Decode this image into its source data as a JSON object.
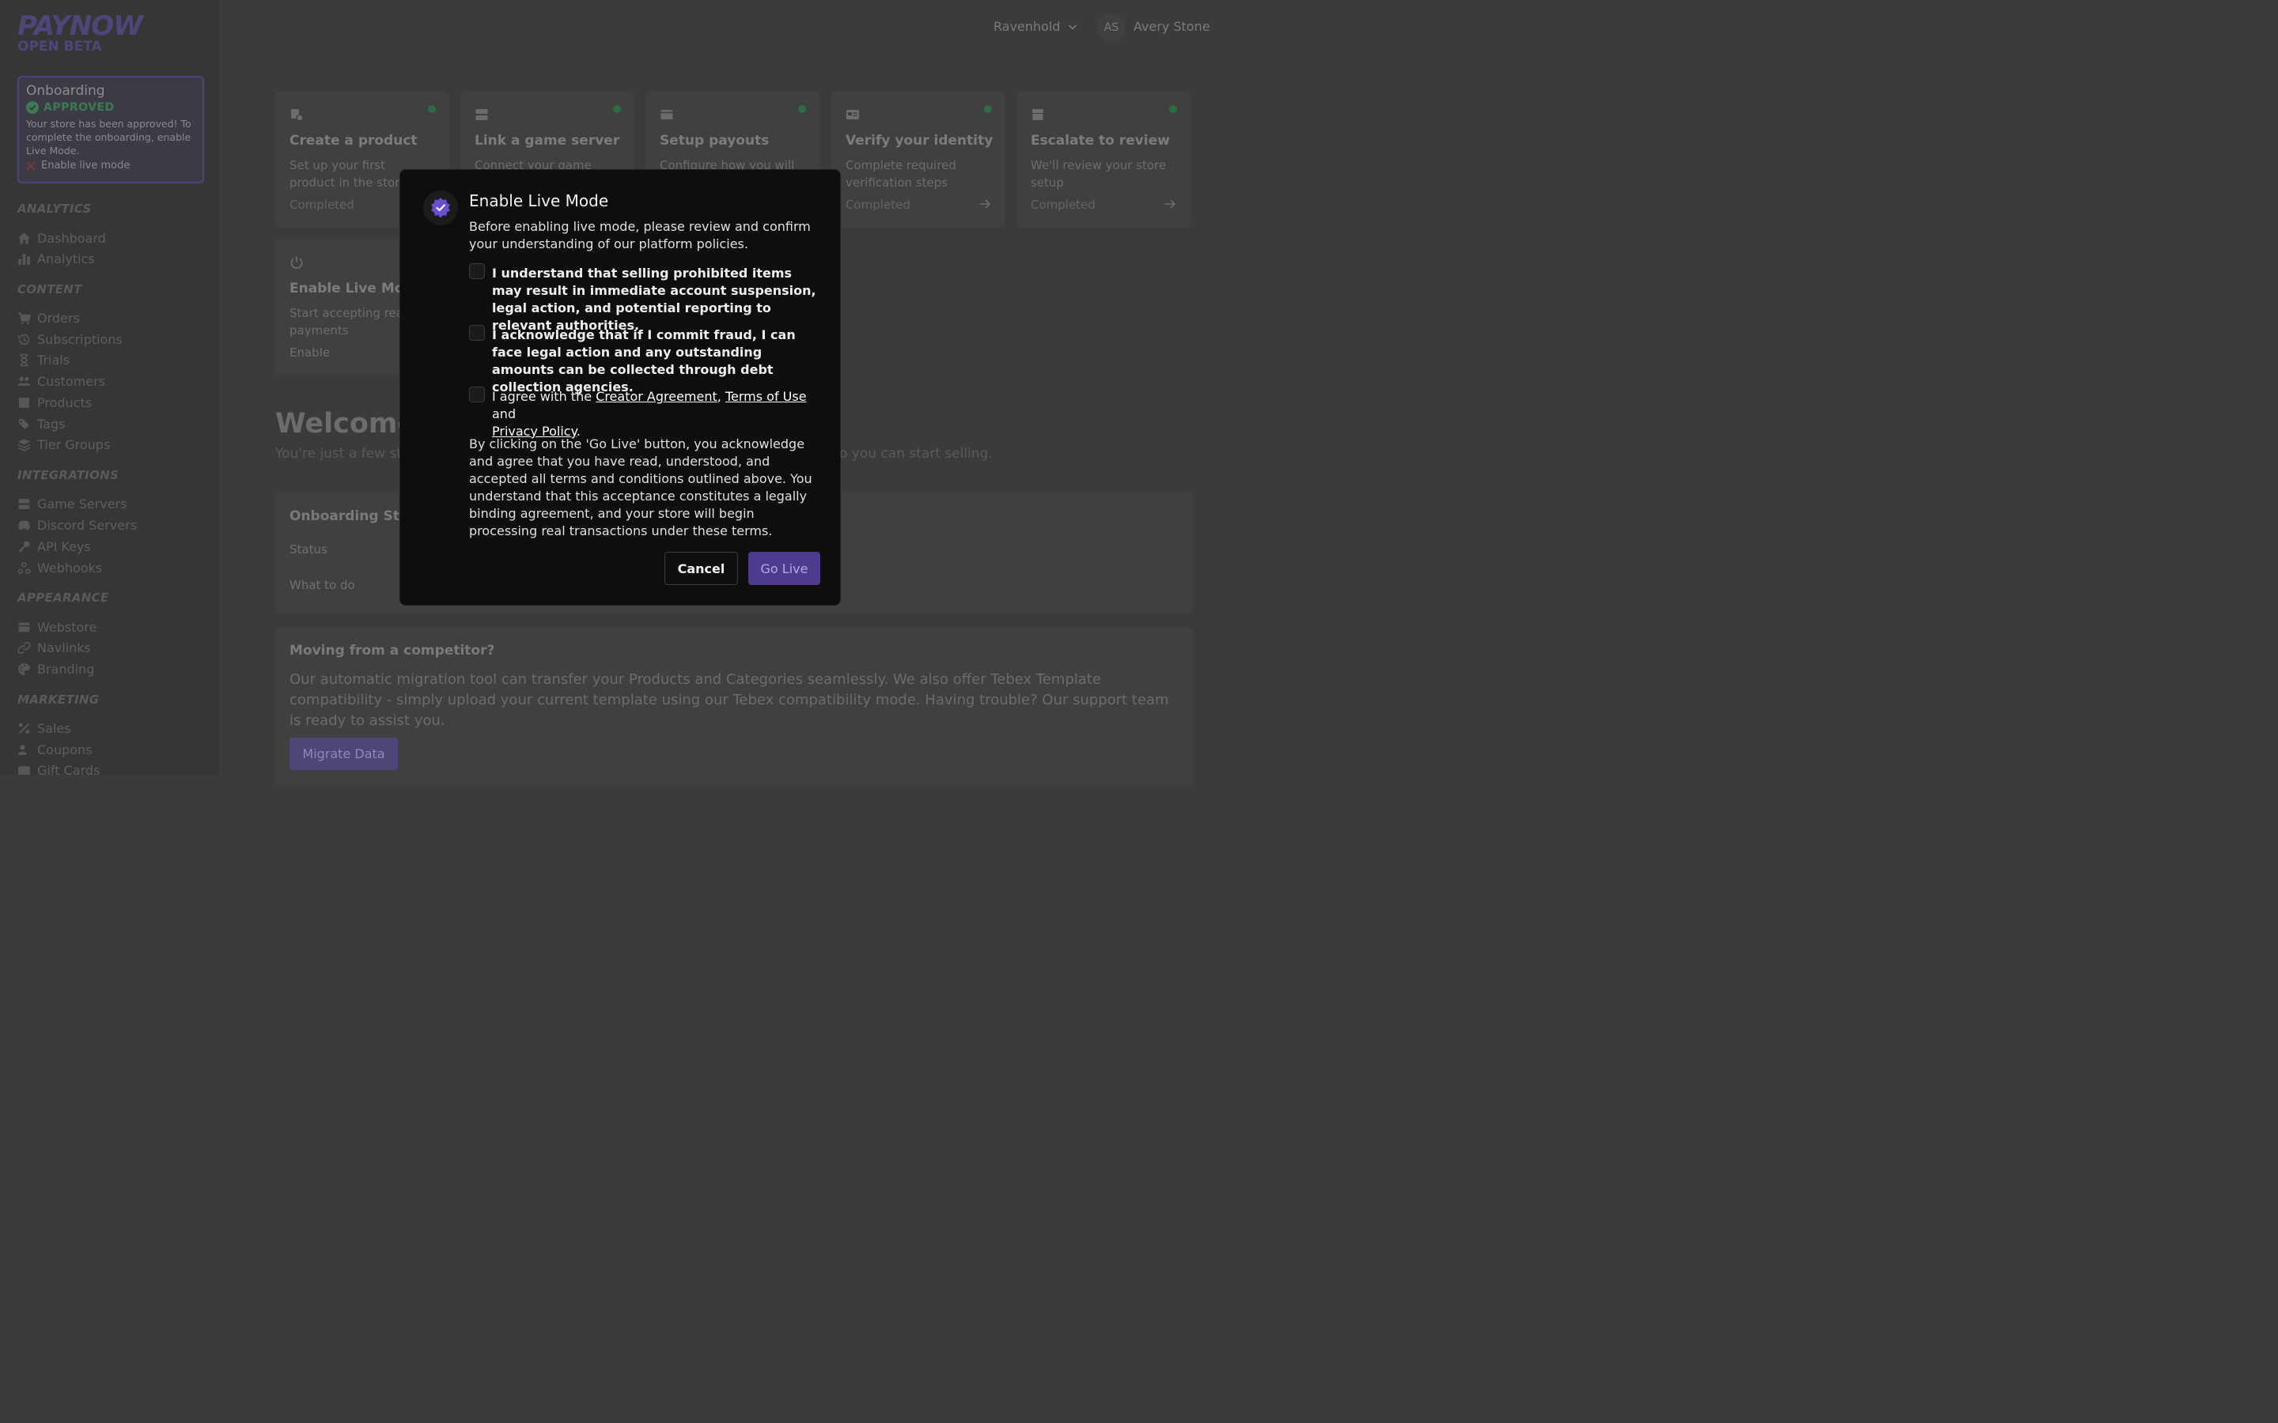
{
  "brand": {
    "name": "PAYNOW",
    "tag": "OPEN BETA",
    "accent": "#4e4679"
  },
  "onboarding_card": {
    "title": "Onboarding",
    "status": "APPROVED",
    "message": "Your store has been approved! To complete the onboarding, enable Live Mode.",
    "todo": "Enable live mode"
  },
  "sidebar": {
    "sections": {
      "analytics": "ANALYTICS",
      "content": "CONTENT",
      "integrations": "INTEGRATIONS",
      "appearance": "APPEARANCE",
      "marketing": "MARKETING"
    },
    "items": {
      "dashboard": "Dashboard",
      "analytics": "Analytics",
      "orders": "Orders",
      "subscriptions": "Subscriptions",
      "trials": "Trials",
      "customers": "Customers",
      "products": "Products",
      "tags": "Tags",
      "tier_groups": "Tier Groups",
      "game_servers": "Game Servers",
      "discord_servers": "Discord Servers",
      "api_keys": "API Keys",
      "webhooks": "Webhooks",
      "webstore": "Webstore",
      "navlinks": "Navlinks",
      "branding": "Branding",
      "sales": "Sales",
      "coupons": "Coupons",
      "gift_cards": "Gift Cards"
    }
  },
  "header": {
    "store": "Ravenhold",
    "avatar_initials": "AS",
    "user": "Avery Stone"
  },
  "steps": [
    {
      "title": "Create a product",
      "desc": "Set up your first product in the store",
      "status": "Completed",
      "icon": "product-icon"
    },
    {
      "title": "Link a game server",
      "desc": "Connect your game",
      "status": "",
      "icon": "server-icon"
    },
    {
      "title": "Setup payouts",
      "desc": "Configure how you will",
      "status": "",
      "icon": "wallet-icon"
    },
    {
      "title": "Verify your identity",
      "desc": "Complete required verification steps",
      "status": "Completed",
      "icon": "id-card-icon"
    },
    {
      "title": "Escalate to review",
      "desc": "We'll review your store setup",
      "status": "Completed",
      "icon": "store-icon"
    },
    {
      "title": "Enable Live Mode",
      "desc": "Start accepting real payments",
      "status": "Enable",
      "icon": "power-icon"
    }
  ],
  "welcome": {
    "title": "Welcome",
    "subtitle_left": "You're just a few st",
    "subtitle_right": "o you can start selling."
  },
  "status_panel": {
    "title": "Onboarding Sta",
    "status_label": "Status",
    "todo_label": "What to do"
  },
  "competitor": {
    "title": "Moving from a competitor?",
    "text": "Our automatic migration tool can transfer your Products and Categories seamlessly. We also offer Tebex Template compatibility - simply upload your current template using our Tebex compatibility mode. Having trouble? Our support team is ready to assist you.",
    "button": "Migrate Data"
  },
  "modal": {
    "title": "Enable Live Mode",
    "description": "Before enabling live mode, please review and confirm your understanding of our platform policies.",
    "checks": [
      "I understand that selling prohibited items may result in immediate account suspension, legal action, and potential reporting to relevant authorities.",
      "I acknowledge that if I commit fraud, I can face legal action and any outstanding amounts can be collected through debt collection agencies."
    ],
    "agree": {
      "prefix": "I agree with the ",
      "creator_agreement": "Creator Agreement",
      "comma": ", ",
      "terms": "Terms of Use",
      "and": " and ",
      "privacy": "Privacy Policy",
      "period": "."
    },
    "fine_print": "By clicking on the 'Go Live' button, you acknowledge and agree that you have read, understood, and accepted all terms and conditions outlined above. You understand that this acceptance constitutes a legally binding agreement, and your store will begin processing real transactions under these terms.",
    "cancel": "Cancel",
    "go_live": "Go Live"
  }
}
